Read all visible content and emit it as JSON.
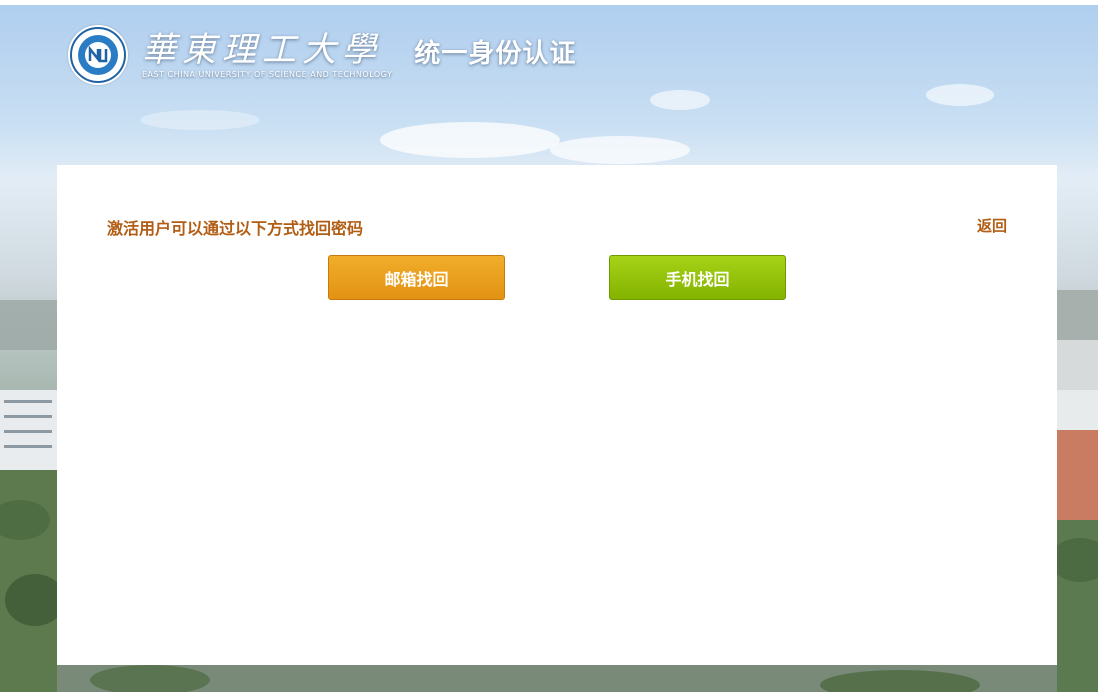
{
  "header": {
    "university_cn": "華東理工大學",
    "university_en": "East China University of Science and Technology",
    "system_title": "统一身份认证"
  },
  "card": {
    "title": "激活用户可以通过以下方式找回密码",
    "back_label": "返回",
    "email_button_label": "邮箱找回",
    "phone_button_label": "手机找回"
  },
  "colors": {
    "title_text": "#b25d14",
    "email_button": "#e9a01c",
    "phone_button": "#93c30a"
  }
}
